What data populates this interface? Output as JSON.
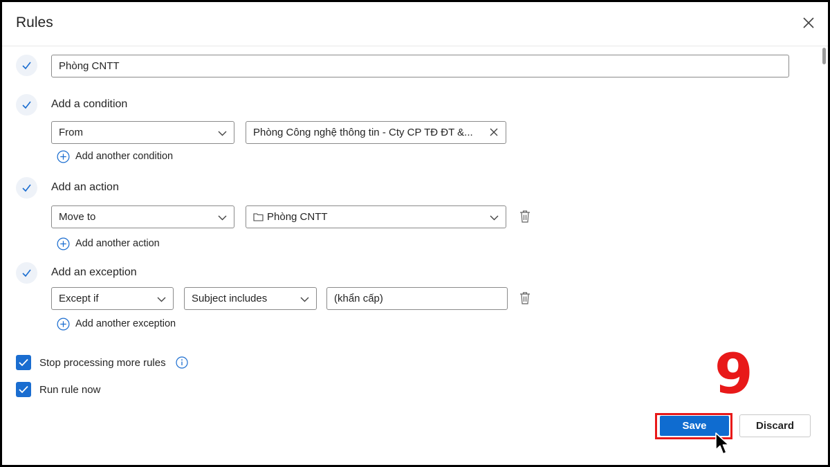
{
  "dialog": {
    "title": "Rules"
  },
  "rule_name": {
    "value": "Phòng CNTT"
  },
  "condition": {
    "label": "Add a condition",
    "field": "From",
    "value": "Phòng Công nghệ thông tin - Cty CP TĐ ĐT &...",
    "add_label": "Add another condition"
  },
  "action": {
    "label": "Add an action",
    "field": "Move to",
    "folder": "Phòng CNTT",
    "add_label": "Add another action"
  },
  "exception": {
    "label": "Add an exception",
    "type": "Except if",
    "field": "Subject includes",
    "value": "(khẩn cấp)",
    "add_label": "Add another exception"
  },
  "options": {
    "stop_processing": {
      "label": "Stop processing more rules",
      "checked": true
    },
    "run_now": {
      "label": "Run rule now",
      "checked": true
    }
  },
  "buttons": {
    "save": "Save",
    "discard": "Discard"
  },
  "annotation": {
    "step": "9"
  },
  "colors": {
    "accent": "#0f6cd0",
    "highlight": "#e81919"
  },
  "icons": [
    "close-icon",
    "check-icon",
    "chevron-down-icon",
    "plus-circle-icon",
    "trash-icon",
    "folder-icon",
    "info-icon",
    "cursor-icon"
  ]
}
